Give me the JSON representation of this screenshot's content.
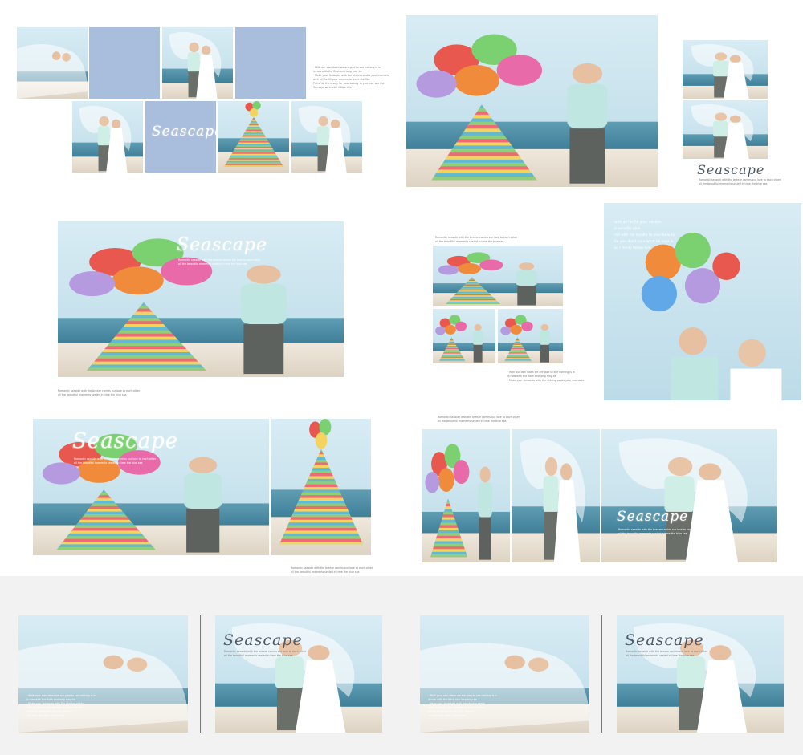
{
  "theme": {
    "sky": "#cde6f1",
    "sea": "#4f8fa6",
    "sand": "#e8e0d3",
    "panel_blue": "#a9bedc",
    "band_grey": "#f2f2f2"
  },
  "spreads": [
    {
      "id": "spread-1",
      "title": "Seascape",
      "caption": [
        "· With our own dawn we are glad to see nothing is in",
        "is now with the flash and long may be",
        "· Make your fantasies with the shining peaks your moments",
        "with all the fill your dreams to leave the flee",
        "Full of all the lovely for your beauty to you may see the",
        "You says we think I follow this"
      ]
    },
    {
      "id": "spread-2",
      "title": "Seascape",
      "caption": [
        "Romantic seaside with the breeze carries our love to each other",
        "all the beautiful moments sealed in time the blue sea"
      ]
    },
    {
      "id": "spread-3",
      "title": "Seascape",
      "caption_top": [
        "Romantic seaside with the breeze carries our love to each other",
        "all the beautiful moments sealed in time the blue sea"
      ],
      "caption_left": [
        "Romantic seaside with the breeze carries our love to each other",
        "all the beautiful moments sealed in time the blue sea"
      ]
    },
    {
      "id": "spread-4",
      "caption_top": [
        "Romantic seaside with the breeze carries our love to each other",
        "all the beautiful moments sealed in time the blue sea"
      ],
      "caption_bottom": [
        "· With our own dawn we are glad to see nothing is in",
        "is now with the flash and long may be",
        "· Make your fantasies with the shining peaks your moments"
      ],
      "poem": [
        "with all his fill your desires",
        "a security give",
        "roll with his loyalty to your beauty",
        "So you don't care what he says &",
        "so I firmly follow him"
      ]
    },
    {
      "id": "spread-5",
      "title": "Seascape",
      "caption": [
        "Romantic seaside with the breeze carries our love to each other",
        "all the beautiful moments sealed in time the blue sea"
      ],
      "caption_bottom": [
        "Romantic seaside with the breeze carries our love to each other",
        "all the beautiful moments sealed in time the blue sea"
      ]
    },
    {
      "id": "spread-6",
      "title": "Seascape",
      "caption": [
        "Romantic seaside with the breeze carries our love to each other",
        "all the beautiful moments sealed in time the blue sea"
      ],
      "caption_top": [
        "Romantic seaside with the breeze carries our love to each other",
        "all the beautiful moments sealed in time the blue sea"
      ]
    },
    {
      "id": "spread-7",
      "title": "Seascape",
      "caption_left": [
        "· Walk your own dawn we are glad to see nothing is in",
        "is now with the flash and long may be",
        "· Make your fantasies with the shining peaks",
        "with all the fill your dreams to leave the flee",
        "Full of all the lovely for your beauty",
        "You says we think I follow this"
      ],
      "caption_right": [
        "Romantic seaside with the breeze carries our love to each other",
        "all the beautiful moments sealed in time the blue sea"
      ]
    },
    {
      "id": "spread-8",
      "title": "Seascape",
      "caption_left": [
        "· Walk your own dawn we are glad to see nothing is in",
        "is now with the flash and long may be",
        "· Make your fantasies with the shining peaks",
        "with all the fill your dreams to leave the flee",
        "Full of all the lovely for your beauty",
        "You says we think I follow this"
      ],
      "caption_right": [
        "Romantic seaside with the breeze carries our love to each other",
        "all the beautiful moments sealed in time the blue sea"
      ]
    }
  ]
}
